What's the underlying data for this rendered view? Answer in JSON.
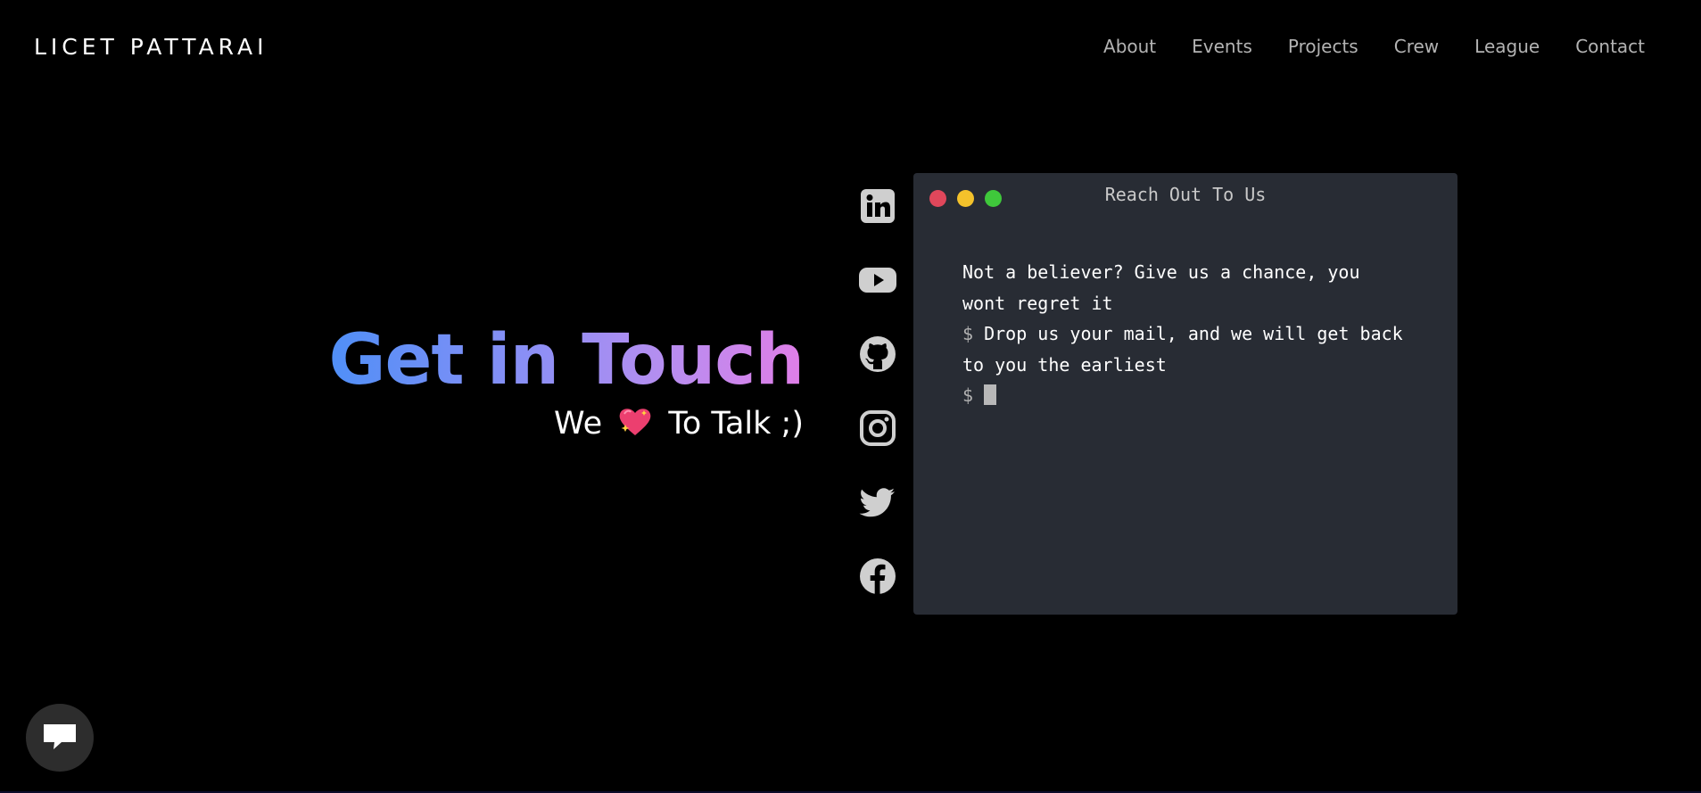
{
  "header": {
    "brand": "LICET PATTARAI",
    "nav": [
      "About",
      "Events",
      "Projects",
      "Crew",
      "League",
      "Contact"
    ]
  },
  "hero": {
    "title": "Get in Touch",
    "subtitle_before": "We",
    "subtitle_emoji": "sparkling-heart-icon",
    "subtitle_after": "To Talk ;)"
  },
  "socials": [
    "linkedin-icon",
    "youtube-icon",
    "github-icon",
    "instagram-icon",
    "twitter-icon",
    "facebook-icon"
  ],
  "terminal": {
    "title": "Reach Out To Us",
    "line1": "Not a believer? Give us a chance, you wont regret it",
    "prompt": "$",
    "line2": "Drop us your mail, and we will get back to you the earliest",
    "input_value": ""
  },
  "colors": {
    "background": "#000000",
    "terminal_bg": "#282c34",
    "gradient_start": "#4f8ff7",
    "gradient_end": "#e07ee8",
    "dot_red": "#e0475b",
    "dot_yellow": "#f4c22b",
    "dot_green": "#3fc83b"
  }
}
